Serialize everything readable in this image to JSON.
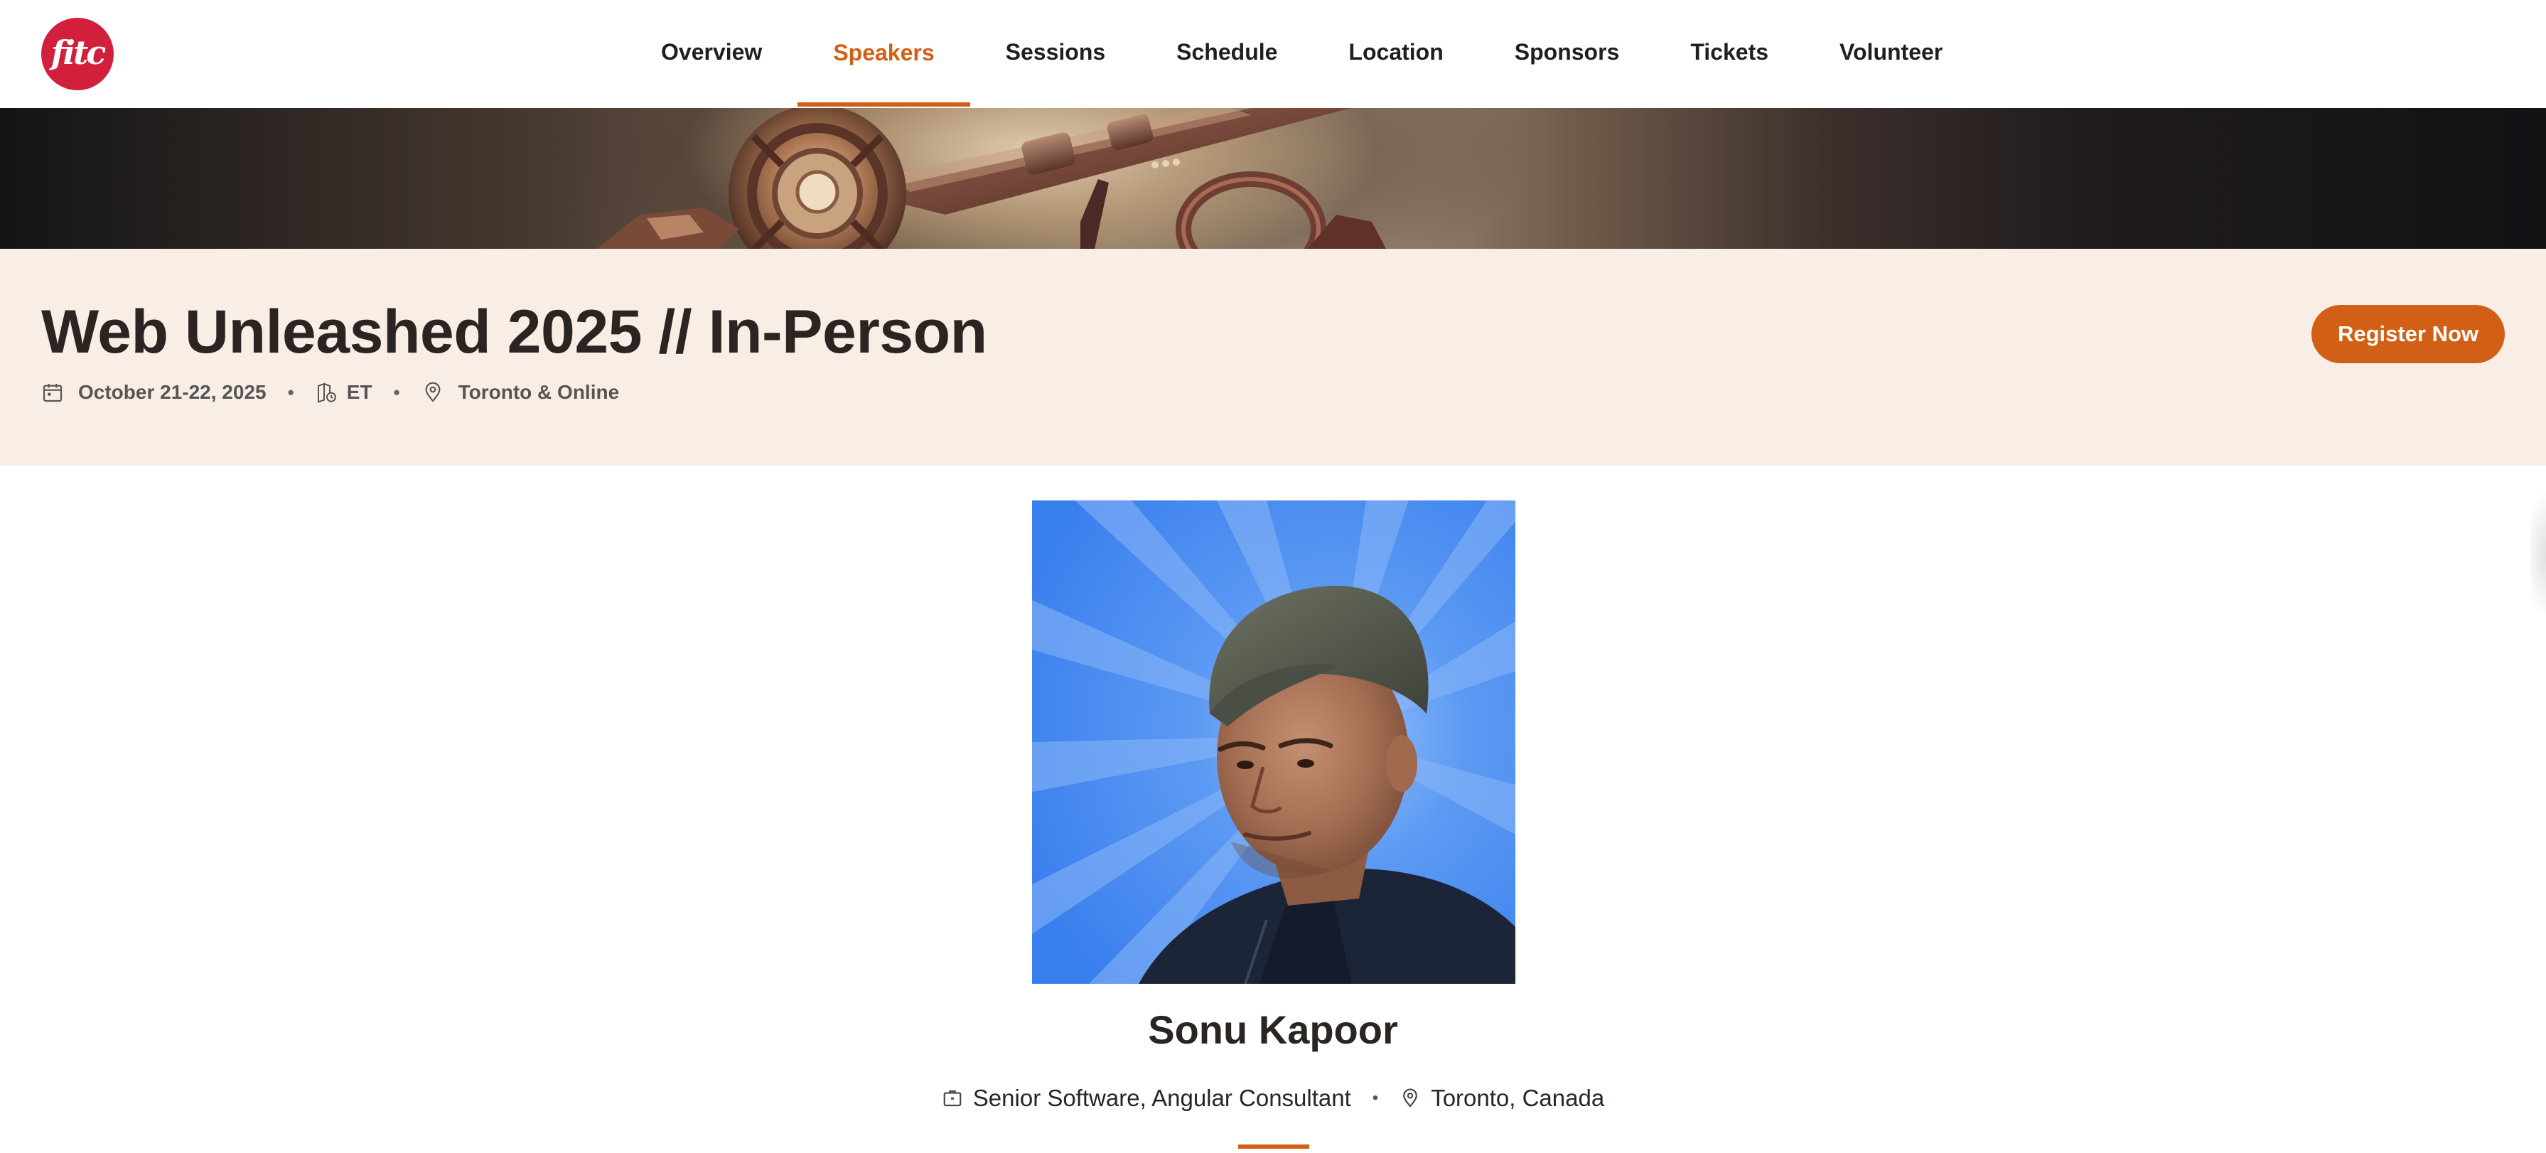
{
  "brand": {
    "logo_text": "fitc",
    "logo_color": "#d21f3c"
  },
  "nav": {
    "items": [
      {
        "label": "Overview",
        "active": false
      },
      {
        "label": "Speakers",
        "active": true
      },
      {
        "label": "Sessions",
        "active": false
      },
      {
        "label": "Schedule",
        "active": false
      },
      {
        "label": "Location",
        "active": false
      },
      {
        "label": "Sponsors",
        "active": false
      },
      {
        "label": "Tickets",
        "active": false
      },
      {
        "label": "Volunteer",
        "active": false
      }
    ],
    "active_color": "#d25f16"
  },
  "event": {
    "title": "Web Unleashed 2025 // In-Person",
    "date": "October 21-22, 2025",
    "timezone": "ET",
    "location": "Toronto & Online",
    "separator": "•",
    "register_label": "Register Now",
    "band_color": "#f9eee5",
    "icons": {
      "date": "calendar-icon",
      "timezone": "timezone-icon",
      "location": "map-pin-icon"
    }
  },
  "speaker": {
    "name": "Sonu Kapoor",
    "title": "Senior Software, Angular Consultant",
    "location": "Toronto, Canada",
    "separator": "•",
    "photo_background": "#3d86f0",
    "icons": {
      "title": "briefcase-icon",
      "location": "map-pin-icon"
    }
  }
}
